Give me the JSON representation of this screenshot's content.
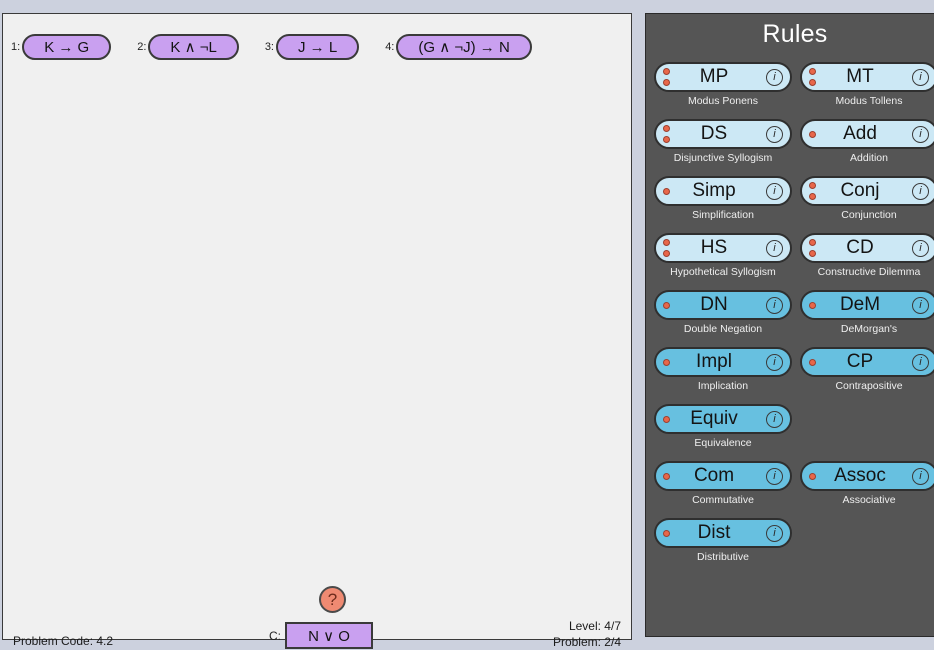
{
  "workspace": {
    "premises": [
      {
        "index": "1:",
        "text": "K → G"
      },
      {
        "index": "2:",
        "text": "K ∧ ¬L"
      },
      {
        "index": "3:",
        "text": "J → L"
      },
      {
        "index": "4:",
        "text": "(G ∧ ¬J) → N"
      }
    ],
    "help_label": "?",
    "conclusion_label": "C:",
    "conclusion_text": "N ∨ O",
    "problem_code": "Problem Code: 4.2",
    "level": "Level: 4/7",
    "problem": "Problem: 2/4"
  },
  "rules": {
    "title": "Rules",
    "rows": [
      [
        {
          "abbr": "MP",
          "name": "Modus Ponens",
          "dots": 2,
          "kind": "inference",
          "info": "ℹ"
        },
        {
          "abbr": "MT",
          "name": "Modus Tollens",
          "dots": 2,
          "kind": "inference",
          "info": "ℹ"
        }
      ],
      [
        {
          "abbr": "DS",
          "name": "Disjunctive Syllogism",
          "dots": 2,
          "kind": "inference",
          "info": "ℹ"
        },
        {
          "abbr": "Add",
          "name": "Addition",
          "dots": 1,
          "kind": "inference",
          "info": "ℹ"
        }
      ],
      [
        {
          "abbr": "Simp",
          "name": "Simplification",
          "dots": 1,
          "kind": "inference",
          "info": "ℹ"
        },
        {
          "abbr": "Conj",
          "name": "Conjunction",
          "dots": 2,
          "kind": "inference",
          "info": "ℹ"
        }
      ],
      [
        {
          "abbr": "HS",
          "name": "Hypothetical Syllogism",
          "dots": 2,
          "kind": "inference",
          "info": "ℹ"
        },
        {
          "abbr": "CD",
          "name": "Constructive Dilemma",
          "dots": 2,
          "kind": "inference",
          "info": "ℹ"
        }
      ],
      [
        {
          "abbr": "DN",
          "name": "Double Negation",
          "dots": 1,
          "kind": "equivalence",
          "info": "ℹ"
        },
        {
          "abbr": "DeM",
          "name": "DeMorgan's",
          "dots": 1,
          "kind": "equivalence",
          "info": "ℹ"
        }
      ],
      [
        {
          "abbr": "Impl",
          "name": "Implication",
          "dots": 1,
          "kind": "equivalence",
          "info": "ℹ"
        },
        {
          "abbr": "CP",
          "name": "Contrapositive",
          "dots": 1,
          "kind": "equivalence",
          "info": "ℹ"
        }
      ],
      [
        {
          "abbr": "Equiv",
          "name": "Equivalence",
          "dots": 1,
          "kind": "equivalence",
          "info": "ℹ"
        },
        null
      ],
      [
        {
          "abbr": "Com",
          "name": "Commutative",
          "dots": 1,
          "kind": "equivalence",
          "info": "ℹ"
        },
        {
          "abbr": "Assoc",
          "name": "Associative",
          "dots": 1,
          "kind": "equivalence",
          "info": "ℹ"
        }
      ],
      [
        {
          "abbr": "Dist",
          "name": "Distributive",
          "dots": 1,
          "kind": "equivalence",
          "info": "ℹ"
        },
        null
      ]
    ]
  },
  "colors": {
    "page_bg": "#ccd1de",
    "workspace_bg": "#f0f0f0",
    "panel_bg": "#555555",
    "premise_fill": "#c9a0f0",
    "inference_fill": "#cce8f5",
    "equivalence_fill": "#67c0e0",
    "dot": "#e8674a",
    "help_fill": "#ef8a72"
  }
}
